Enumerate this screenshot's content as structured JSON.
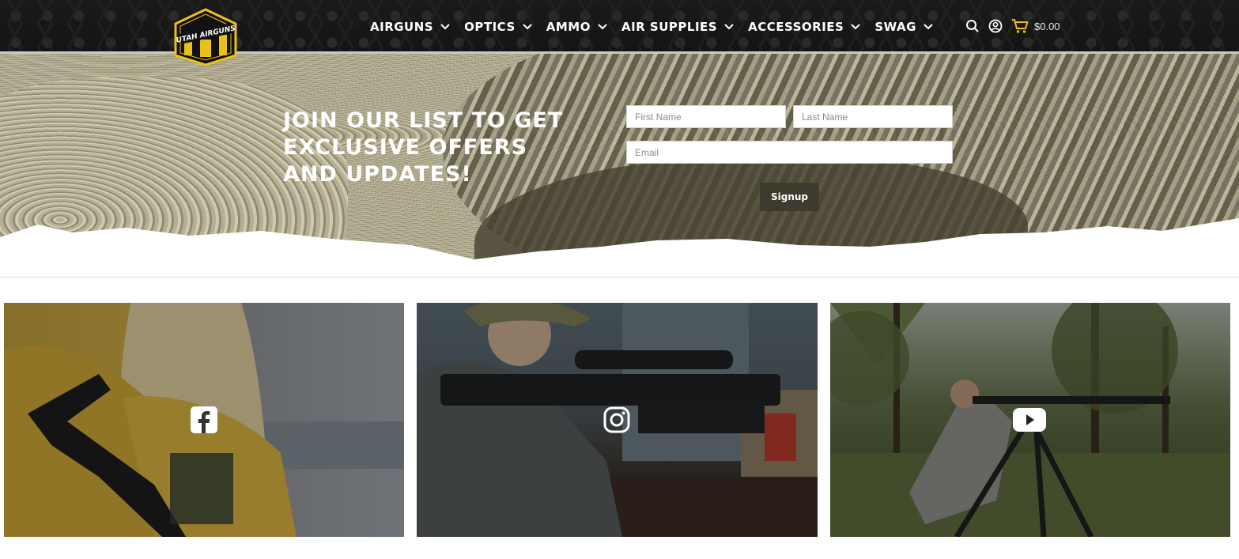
{
  "header": {
    "logo_text": "UTAH AIRGUNS",
    "nav": [
      {
        "label": "AIRGUNS"
      },
      {
        "label": "OPTICS"
      },
      {
        "label": "AMMO"
      },
      {
        "label": "AIR SUPPLIES"
      },
      {
        "label": "ACCESSORIES"
      },
      {
        "label": "SWAG"
      }
    ],
    "icons": [
      "search-icon",
      "account-icon",
      "cart-icon"
    ],
    "cart_total": "$0.00",
    "accent_color": "#e8c21a"
  },
  "signup": {
    "title": "JOIN OUR LIST TO GET EXCLUSIVE OFFERS AND UPDATES!",
    "first_name_placeholder": "First Name",
    "last_name_placeholder": "Last Name",
    "email_placeholder": "Email",
    "button_label": "Signup"
  },
  "social": [
    {
      "network": "facebook",
      "icon": "facebook-icon"
    },
    {
      "network": "instagram",
      "icon": "instagram-icon"
    },
    {
      "network": "youtube",
      "icon": "youtube-icon"
    }
  ]
}
